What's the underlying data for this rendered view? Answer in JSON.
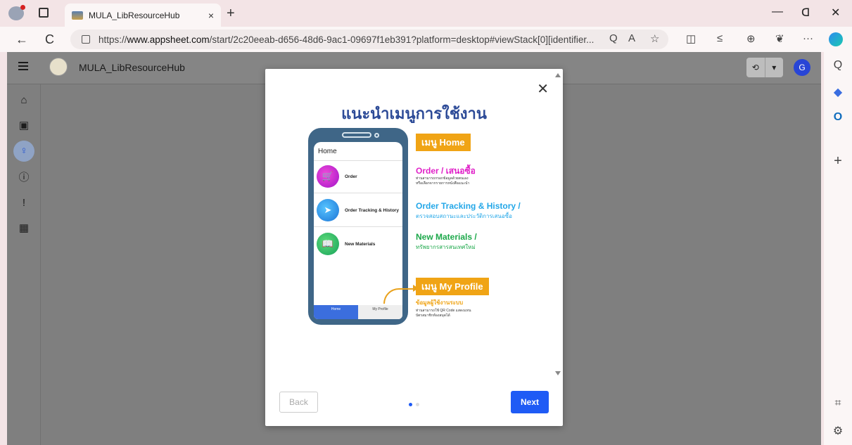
{
  "browser": {
    "tab_title": "MULA_LibResourceHub",
    "tab_close": "×",
    "new_tab": "+",
    "url_prefix": "https://",
    "url_domain": "www.appsheet.com",
    "url_rest": "/start/2c20eeab-d656-48d6-9ac1-09697f1eb391?platform=desktop#viewStack[0][identifier...",
    "back_glyph": "←",
    "reload_glyph": "C",
    "minimize": "—",
    "restore": "ᗡ",
    "close": "✕",
    "url_icons": [
      "Q",
      "A",
      "☆"
    ],
    "toolbar_icons": [
      "◫",
      "≤",
      "⊕",
      "❦",
      "···"
    ],
    "side_icons": [
      "Q",
      "◆",
      "O",
      "+",
      "⌗",
      "⚙"
    ]
  },
  "app": {
    "title": "MULA_LibResourceHub",
    "avatar_letter": "G",
    "sync_glyph": "⟲",
    "dropdown_glyph": "▾",
    "nav_icons": [
      "⌂",
      "▣",
      "♀",
      "ⓘ",
      "!",
      "▦"
    ]
  },
  "modal": {
    "close_glyph": "✕",
    "title": "แนะนำเมนูการใช้งาน",
    "phone": {
      "screen_title": "Home",
      "items": [
        {
          "label": "Order",
          "icon": "🛒"
        },
        {
          "label": "Order Tracking & History",
          "icon": "➤"
        },
        {
          "label": "New Materials",
          "icon": "📖"
        }
      ],
      "bottom_home": "Home",
      "bottom_profile": "My Profile"
    },
    "menu_home_badge": "เมนู Home",
    "order_title": "Order / เสนอซื้อ",
    "order_desc_1": "ท่านสามารถกรอกข้อมูลด้วยตนเอง",
    "order_desc_2": "หรือเลือกจากรายการหนังสือแนะนำ",
    "tracking_title": "Order Tracking & History /",
    "tracking_desc": "ตรวจสอบสถานะและประวัติการเสนอซื้อ",
    "new_title": "New Materials /",
    "new_desc": "ทรัพยากรสารสนเทศใหม่",
    "menu_profile_badge": "เมนู My Profile",
    "profile_title": "ข้อมูลผู้ใช้งานระบบ",
    "profile_desc_1": "ท่านสามารถใช้ QR Code แสดงแทน",
    "profile_desc_2": "บัตรสมาชิกห้องสมุดได้",
    "back_label": "Back",
    "next_label": "Next"
  },
  "colors": {
    "accent": "#1f5bf5",
    "title_blue": "#2c4a97",
    "magenta": "#e020c8",
    "cyan": "#23a7e8",
    "green": "#1ca84a",
    "orange": "#f0a415"
  }
}
